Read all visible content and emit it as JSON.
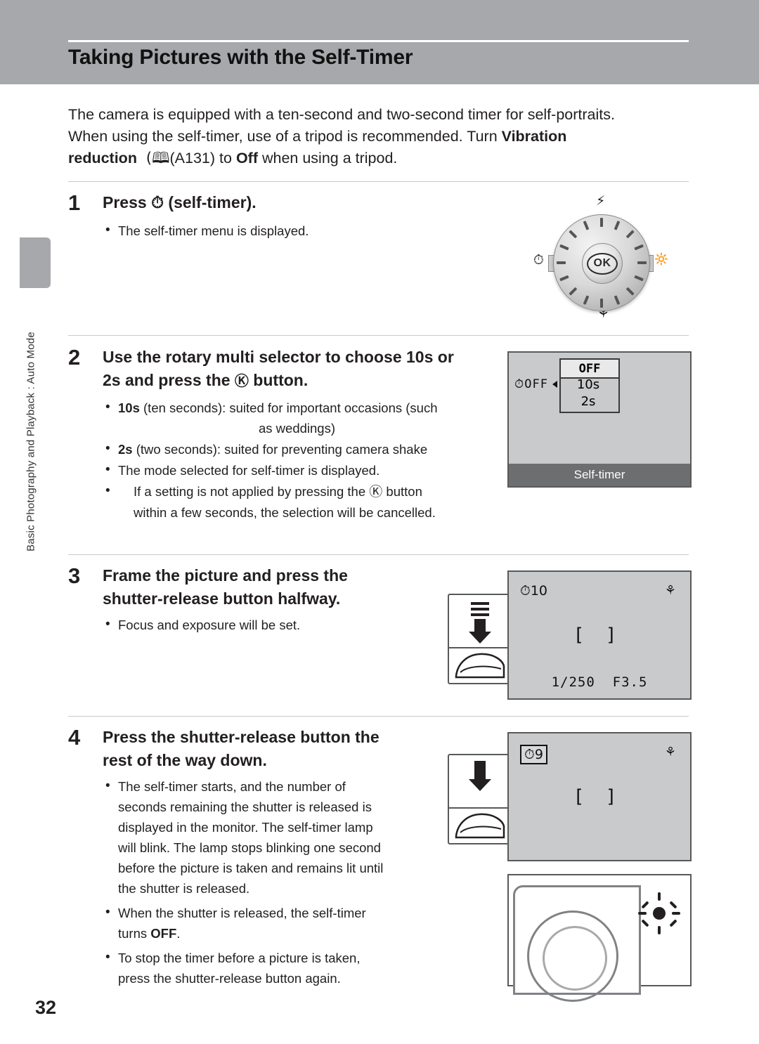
{
  "page": {
    "title": "Taking Pictures with the Self-Timer",
    "number": "32",
    "side_tab_label": "Basic Photography and Playback : Auto Mode"
  },
  "intro": {
    "line1": "The camera is equipped with a ten-second and two-second timer for self-portraits.",
    "line2_pre": "When using the self-timer, use of a tripod is recommended. Turn ",
    "line2_bold": "Vibration",
    "line3_bold": "reduction",
    "line3_ref": "(A131) to ",
    "line3_off": "Off",
    "line3_post": " when using a tripod."
  },
  "steps": [
    {
      "num": "1",
      "heading_pre": "Press ",
      "heading_icon": "self-timer-icon",
      "heading_post": " (self-timer).",
      "bullets": [
        "The self-timer menu is displayed."
      ]
    },
    {
      "num": "2",
      "heading_line1_pre": "Use the rotary multi selector to choose ",
      "heading_line1_bold": "10s",
      "heading_line1_post": " or",
      "heading_line2_bold": "2s",
      "heading_line2_mid": " and press the ",
      "heading_line2_icon": "ok-button-icon",
      "heading_line2_post": " button.",
      "bullets": [
        {
          "bold": "10s",
          "text": " (ten seconds): suited for important occasions (such",
          "cont": "as weddings)"
        },
        {
          "bold": "2s",
          "text": " (two seconds):  suited for preventing camera shake"
        },
        {
          "bold": "",
          "text": "The mode selected for self-timer is displayed."
        },
        {
          "bold": "",
          "text": "If a setting is not applied by pressing the k button",
          "cont": "within a few seconds, the selection will be cancelled."
        }
      ]
    },
    {
      "num": "3",
      "heading_line1": "Frame the picture and press the",
      "heading_line2": "shutter-release button halfway.",
      "bullets": [
        "Focus and exposure will be set."
      ]
    },
    {
      "num": "4",
      "heading_line1": "Press the shutter-release button the",
      "heading_line2": "rest of the way down.",
      "bullets": [
        "The self-timer starts, and the number of",
        "seconds remaining the shutter is released is",
        "displayed in the monitor. The self-timer lamp",
        "will blink. The lamp stops blinking one second",
        "before the picture is taken and remains lit until",
        "the shutter is released.",
        "When the shutter is released, the self-timer",
        "turns OFF.",
        "To stop the timer before a picture is taken,",
        "press the shutter-release button again."
      ]
    }
  ],
  "dial": {
    "ok_label": "OK",
    "top_icon": "flash-icon",
    "left_icon": "self-timer-icon",
    "right_icon": "exposure-compensation-icon",
    "bottom_icon": "macro-icon"
  },
  "lcd_self_timer": {
    "left_indicator": "OFF",
    "option_off": "OFF",
    "option_10s": "10s",
    "option_2s": "2s",
    "menu_title": "Self-timer"
  },
  "lcd_shoot_halfway": {
    "timer_indicator": "10",
    "macro_indicator": "macro-icon",
    "shutter_speed": "1/250",
    "aperture": "F3.5"
  },
  "lcd_shoot_full": {
    "timer_indicator": "9",
    "macro_indicator": "macro-icon"
  }
}
